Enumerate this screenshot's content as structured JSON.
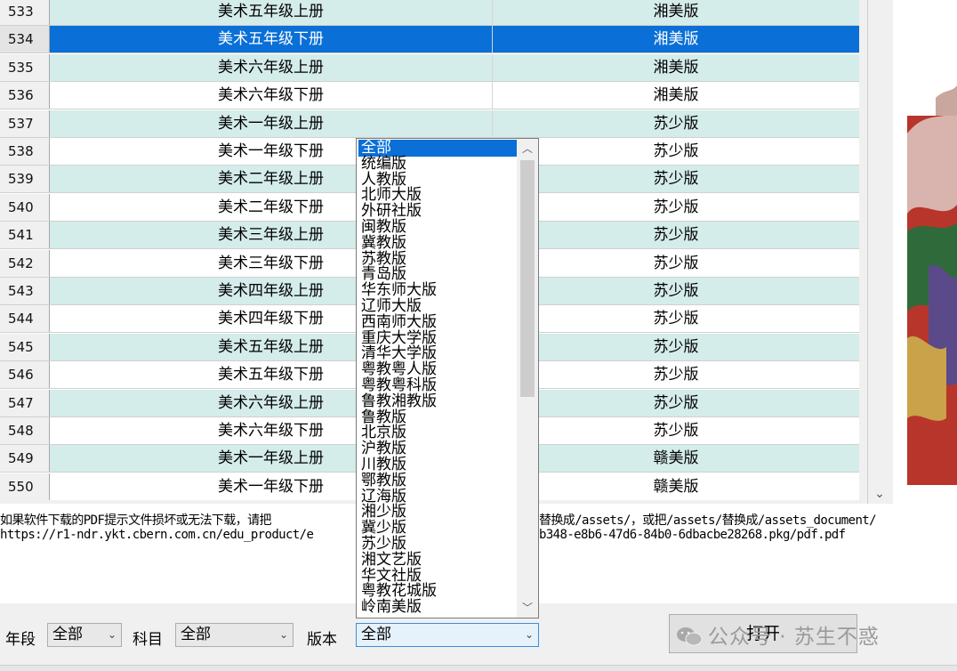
{
  "table": {
    "selected_index": 1,
    "rows": [
      {
        "num": "533",
        "name": "美术五年级上册",
        "edition": "湘美版"
      },
      {
        "num": "534",
        "name": "美术五年级下册",
        "edition": "湘美版"
      },
      {
        "num": "535",
        "name": "美术六年级上册",
        "edition": "湘美版"
      },
      {
        "num": "536",
        "name": "美术六年级下册",
        "edition": "湘美版"
      },
      {
        "num": "537",
        "name": "美术一年级上册",
        "edition": "苏少版"
      },
      {
        "num": "538",
        "name": "美术一年级下册",
        "edition": "苏少版"
      },
      {
        "num": "539",
        "name": "美术二年级上册",
        "edition": "苏少版"
      },
      {
        "num": "540",
        "name": "美术二年级下册",
        "edition": "苏少版"
      },
      {
        "num": "541",
        "name": "美术三年级上册",
        "edition": "苏少版"
      },
      {
        "num": "542",
        "name": "美术三年级下册",
        "edition": "苏少版"
      },
      {
        "num": "543",
        "name": "美术四年级上册",
        "edition": "苏少版"
      },
      {
        "num": "544",
        "name": "美术四年级下册",
        "edition": "苏少版"
      },
      {
        "num": "545",
        "name": "美术五年级上册",
        "edition": "苏少版"
      },
      {
        "num": "546",
        "name": "美术五年级下册",
        "edition": "苏少版"
      },
      {
        "num": "547",
        "name": "美术六年级上册",
        "edition": "苏少版"
      },
      {
        "num": "548",
        "name": "美术六年级下册",
        "edition": "苏少版"
      },
      {
        "num": "549",
        "name": "美术一年级上册",
        "edition": "赣美版"
      },
      {
        "num": "550",
        "name": "美术一年级下册",
        "edition": "赣美版"
      }
    ]
  },
  "log": {
    "line1_left": "如果软件下载的PDF提示文件损坏或无法下载，请把",
    "line1_right": "替换成/assets/，或把/assets/替换成/assets_document/",
    "line2_left": "https://r1-ndr.ykt.cbern.com.cn/edu_product/e",
    "line2_right": "b348-e8b6-47d6-84b0-6dbacbe28268.pkg/pdf.pdf"
  },
  "filters": {
    "grade_label": "年段",
    "grade_value": "全部",
    "subject_label": "科目",
    "subject_value": "全部",
    "edition_label": "版本",
    "edition_value": "全部"
  },
  "open_button": "打开",
  "watermark": "公众号 · 苏生不惑",
  "dropdown": {
    "highlighted_index": 0,
    "options": [
      "全部",
      "统编版",
      "人教版",
      "北师大版",
      "外研社版",
      "闽教版",
      "冀教版",
      "苏教版",
      "青岛版",
      "华东师大版",
      "辽师大版",
      "西南师大版",
      "重庆大学版",
      "清华大学版",
      "粤教粤人版",
      "粤教粤科版",
      "鲁教湘教版",
      "鲁教版",
      "北京版",
      "沪教版",
      "川教版",
      "鄂教版",
      "辽海版",
      "湘少版",
      "冀少版",
      "苏少版",
      "湘文艺版",
      "华文社版",
      "粤教花城版",
      "岭南美版"
    ]
  },
  "colors": {
    "selection": "#0a6fd6",
    "alt_row": "#d4ecea"
  }
}
